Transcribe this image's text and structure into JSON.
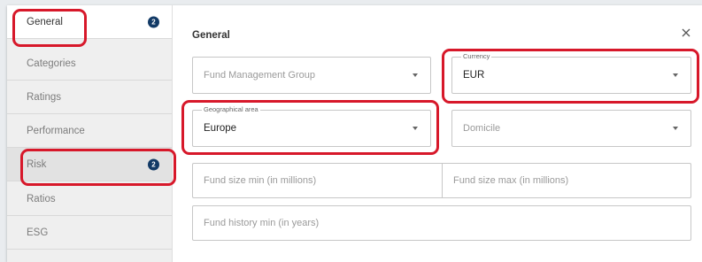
{
  "sidebar": {
    "items": [
      {
        "label": "General",
        "badge": "2"
      },
      {
        "label": "Categories"
      },
      {
        "label": "Ratings"
      },
      {
        "label": "Performance"
      },
      {
        "label": "Risk",
        "badge": "2"
      },
      {
        "label": "Ratios"
      },
      {
        "label": "ESG"
      }
    ]
  },
  "main": {
    "title": "General",
    "fields": {
      "fund_management_group": {
        "placeholder": "Fund Management Group"
      },
      "currency": {
        "label": "Currency",
        "value": "EUR"
      },
      "geographical_area": {
        "label": "Geographical area",
        "value": "Europe"
      },
      "domicile": {
        "placeholder": "Domicile"
      },
      "fund_size_min": {
        "placeholder": "Fund size min (in millions)"
      },
      "fund_size_max": {
        "placeholder": "Fund size max (in millions)"
      },
      "fund_history_min": {
        "placeholder": "Fund history min (in years)"
      }
    }
  },
  "icons": {
    "close": "close-icon",
    "dropdown": "caret-down-icon"
  },
  "colors": {
    "badge": "#123a66",
    "highlight": "#d7182a",
    "sidebar_bg": "#efefef"
  }
}
